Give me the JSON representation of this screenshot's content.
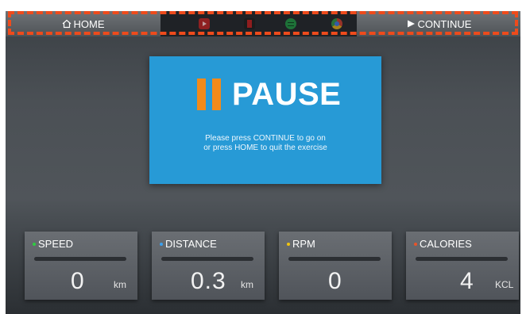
{
  "topbar": {
    "home_label": "HOME",
    "continue_label": "CONTINUE",
    "home_icon": "home-icon",
    "continue_icon": "play-icon",
    "apps": [
      "youtube-icon",
      "netflix-icon",
      "spotify-icon",
      "chrome-icon"
    ]
  },
  "dialog": {
    "title": "PAUSE",
    "message_line1": "Please press CONTINUE to go on",
    "message_line2": "or press HOME to quit the exercise"
  },
  "stats": {
    "speed": {
      "label": "SPEED",
      "value": "0",
      "unit": "km",
      "dot_color": "#2ecc40"
    },
    "distance": {
      "label": "DISTANCE",
      "value": "0.3",
      "unit": "km",
      "dot_color": "#3aa0f0"
    },
    "rpm": {
      "label": "RPM",
      "value": "0",
      "unit": "",
      "dot_color": "#f1c40f"
    },
    "calories": {
      "label": "CALORIES",
      "value": "4",
      "unit": "KCL",
      "dot_color": "#e8542a"
    }
  },
  "colors": {
    "dialog_bg": "#279ad6",
    "pause_accent": "#f28a1a",
    "highlight_dash": "#ee4b1c"
  }
}
